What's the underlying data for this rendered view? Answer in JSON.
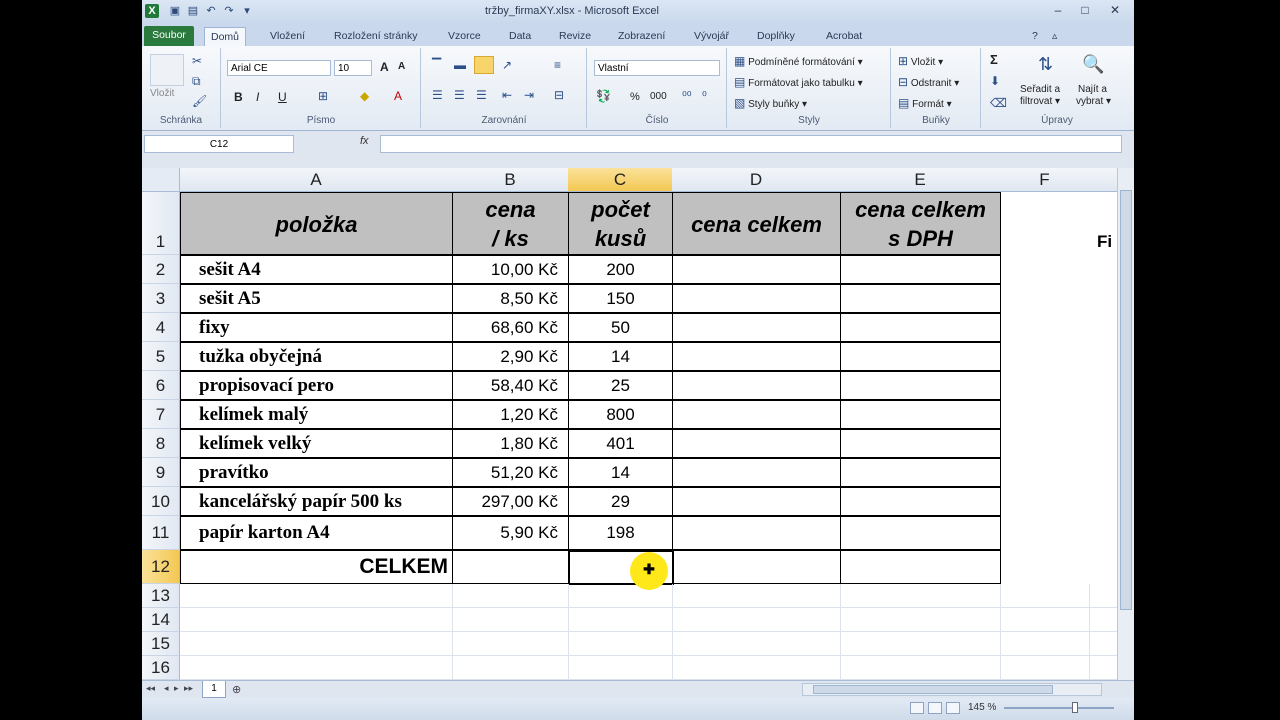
{
  "window": {
    "title": "tržby_firmaXY.xlsx - Microsoft Excel",
    "min": "–",
    "max": "□",
    "close": "✕"
  },
  "ribbon": {
    "tabs": [
      "Soubor",
      "Domů",
      "Vložení",
      "Rozložení stránky",
      "Vzorce",
      "Data",
      "Revize",
      "Zobrazení",
      "Vývojář",
      "Doplňky",
      "Acrobat"
    ],
    "groups": {
      "clipboard": {
        "label": "Schránka",
        "paste": "Vložit"
      },
      "font": {
        "label": "Písmo",
        "font_name": "Arial CE",
        "font_size": "10",
        "bold": "B",
        "italic": "I",
        "underline": "U",
        "grow": "A",
        "shrink": "A"
      },
      "alignment": {
        "label": "Zarovnání"
      },
      "number": {
        "label": "Číslo",
        "format": "Vlastní",
        "percent": "%",
        "thousands": "000"
      },
      "styles": {
        "label": "Styly",
        "conditional": "Podmíněné formátování ▾",
        "as_table": "Formátovat jako tabulku ▾",
        "cell_styles": "Styly buňky ▾"
      },
      "cells": {
        "label": "Buňky",
        "insert": "Vložit ▾",
        "delete": "Odstranit ▾",
        "format": "Formát ▾"
      },
      "editing": {
        "label": "Úpravy",
        "sort_l1": "Seřadit a",
        "sort_l2": "filtrovat ▾",
        "find_l1": "Najít a",
        "find_l2": "vybrat ▾",
        "sum": "Σ"
      }
    }
  },
  "formula_bar": {
    "name_box": "C12",
    "fx": "fx",
    "value": ""
  },
  "grid": {
    "columns": [
      "A",
      "B",
      "C",
      "D",
      "E",
      "F"
    ],
    "selected_column": "C",
    "rows": [
      "1",
      "2",
      "3",
      "4",
      "5",
      "6",
      "7",
      "8",
      "9",
      "10",
      "11",
      "12",
      "13",
      "14",
      "15",
      "16"
    ],
    "selected_row": "12",
    "header": {
      "a": "položka",
      "b1": "cena",
      "b2": "/ ks",
      "c1": "počet",
      "c2": "kusů",
      "d": "cena celkem",
      "e1": "cena celkem",
      "e2": "s DPH"
    },
    "items": [
      {
        "name": "sešit A4",
        "price": "10,00 Kč",
        "qty": "200"
      },
      {
        "name": "sešit A5",
        "price": "8,50 Kč",
        "qty": "150"
      },
      {
        "name": "fixy",
        "price": "68,60 Kč",
        "qty": "50"
      },
      {
        "name": "tužka obyčejná",
        "price": "2,90 Kč",
        "qty": "14"
      },
      {
        "name": "propisovací pero",
        "price": "58,40 Kč",
        "qty": "25"
      },
      {
        "name": "kelímek malý",
        "price": "1,20 Kč",
        "qty": "800"
      },
      {
        "name": "kelímek velký",
        "price": "1,80 Kč",
        "qty": "401"
      },
      {
        "name": "pravítko",
        "price": "51,20 Kč",
        "qty": "14"
      },
      {
        "name": "kancelářský papír 500 ks",
        "price": "297,00 Kč",
        "qty": "29"
      },
      {
        "name": "papír karton A4",
        "price": "5,90 Kč",
        "qty": "198"
      }
    ],
    "total_label": "CELKEM",
    "f_cut_text": "Fi"
  },
  "sheets": {
    "active": "1"
  },
  "status": {
    "zoom": "145 %"
  },
  "colors": {
    "header_fill": "#c0c0c0",
    "selection_header": "#f3c752",
    "cursor": "#ffe81a",
    "file_tab": "#2a7a3e"
  }
}
